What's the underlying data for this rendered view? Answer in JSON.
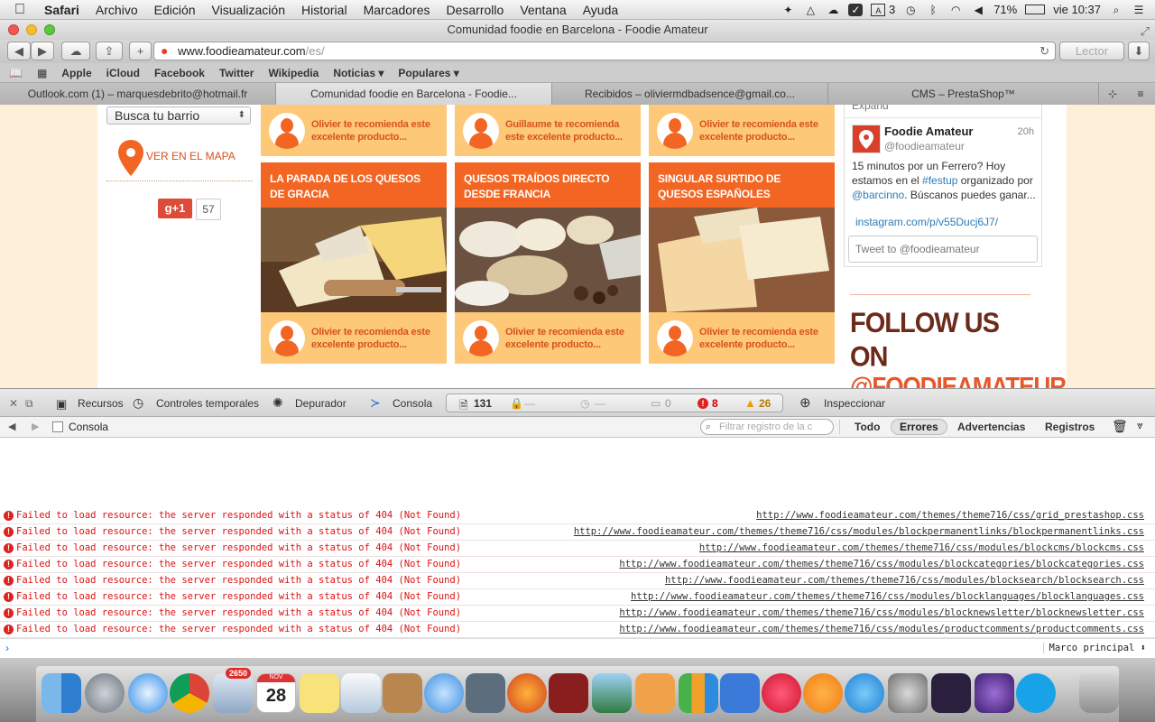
{
  "menubar": {
    "apple": "",
    "app_name": "Safari",
    "items": [
      "Archivo",
      "Edición",
      "Visualización",
      "Historial",
      "Marcadores",
      "Desarrollo",
      "Ventana",
      "Ayuda"
    ],
    "status": {
      "adobe_count": "3",
      "battery": "71%",
      "clock": "vie 10:37"
    }
  },
  "window": {
    "title": "Comunidad foodie en Barcelona - Foodie Amateur",
    "url_domain": "www.foodieamateur.com",
    "url_path": "/es/",
    "reader_label": "Lector"
  },
  "bookmarks": [
    "Apple",
    "iCloud",
    "Facebook",
    "Twitter",
    "Wikipedia",
    "Noticias ▾",
    "Populares ▾"
  ],
  "tabs": [
    {
      "label": "Outlook.com (1) – marquesdebrito@hotmail.fr"
    },
    {
      "label": "Comunidad foodie en Barcelona - Foodie..."
    },
    {
      "label": "Recibidos – oliviermdbadsence@gmail.co..."
    },
    {
      "label": "CMS – PrestaShop™"
    }
  ],
  "sidebar": {
    "neighborhood_select": "Busca tu barrio",
    "map_link": "VER EN EL MAPA",
    "gplus_label": "g+1",
    "gplus_count": "57"
  },
  "cards": {
    "recommendations_top": [
      {
        "text": "Olivier te recomienda este excelente producto..."
      },
      {
        "text": "Guillaume te recomienda este excelente producto..."
      },
      {
        "text": "Olivier te recomienda este excelente producto..."
      }
    ],
    "products": [
      {
        "title": "LA PARADA DE LOS QUESOS DE GRACIA",
        "rec": "Olivier te recomienda este excelente producto..."
      },
      {
        "title": "QUESOS TRAÍDOS DIRECTO DESDE FRANCIA",
        "rec": "Olivier te recomienda este excelente producto..."
      },
      {
        "title": "SINGULAR SURTIDO DE QUESOS ESPAÑOLES",
        "rec": "Olivier te recomienda este excelente producto..."
      }
    ]
  },
  "twitter": {
    "expand": "Expand",
    "name": "Foodie Amateur",
    "handle": "@foodieamateur",
    "time": "20h",
    "text_1": "15 minutos por un Ferrero? Hoy estamos en el ",
    "hashtag": "#festup",
    "text_2": " organizado por ",
    "mention": "@barcinno",
    "text_3": ". Búscanos puedes ganar...",
    "link": "instagram.com/p/v55Ducj6J7/",
    "tweet_placeholder": "Tweet to @foodieamateur",
    "follow_line1": "FOLLOW US ON",
    "follow_line2": "@FOODIEAMATEUR"
  },
  "devtools": {
    "resources": "Recursos",
    "timelines": "Controles temporales",
    "debugger": "Depurador",
    "console": "Consola",
    "count_resources": "131",
    "count_locks": "—",
    "count_time": "—",
    "count_messages": "0",
    "count_errors": "8",
    "count_warnings": "26",
    "inspect": "Inspeccionar",
    "console_label": "Consola",
    "filter_placeholder": "Filtrar registro de la c",
    "filter_all": "Todo",
    "filter_errors": "Errores",
    "filter_warnings": "Advertencias",
    "filter_logs": "Registros",
    "frame": "Marco principal"
  },
  "console_rows": [
    {
      "msg": "Failed to load resource: the server responded with a status of 404 (Not Found)",
      "url": "http://www.foodieamateur.com/themes/theme716/css/grid_prestashop.css"
    },
    {
      "msg": "Failed to load resource: the server responded with a status of 404 (Not Found)",
      "url": "http://www.foodieamateur.com/themes/theme716/css/modules/blockpermanentlinks/blockpermanentlinks.css"
    },
    {
      "msg": "Failed to load resource: the server responded with a status of 404 (Not Found)",
      "url": "http://www.foodieamateur.com/themes/theme716/css/modules/blockcms/blockcms.css"
    },
    {
      "msg": "Failed to load resource: the server responded with a status of 404 (Not Found)",
      "url": "http://www.foodieamateur.com/themes/theme716/css/modules/blockcategories/blockcategories.css"
    },
    {
      "msg": "Failed to load resource: the server responded with a status of 404 (Not Found)",
      "url": "http://www.foodieamateur.com/themes/theme716/css/modules/blocksearch/blocksearch.css"
    },
    {
      "msg": "Failed to load resource: the server responded with a status of 404 (Not Found)",
      "url": "http://www.foodieamateur.com/themes/theme716/css/modules/blocklanguages/blocklanguages.css"
    },
    {
      "msg": "Failed to load resource: the server responded with a status of 404 (Not Found)",
      "url": "http://www.foodieamateur.com/themes/theme716/css/modules/blocknewsletter/blocknewsletter.css"
    },
    {
      "msg": "Failed to load resource: the server responded with a status of 404 (Not Found)",
      "url": "http://www.foodieamateur.com/themes/theme716/css/modules/productcomments/productcomments.css"
    }
  ],
  "dock": {
    "badge_mail": "2650",
    "calendar_month": "NOV",
    "calendar_day": "28",
    "icons": [
      "finder-icon",
      "launchpad-icon",
      "safari-icon",
      "chrome-icon",
      "mail-icon",
      "calendar-icon",
      "notes-icon",
      "preview-icon",
      "contacts-icon",
      "messages-icon",
      "facetime-icon",
      "firefox-icon",
      "photobooth-icon",
      "iphoto-icon",
      "pages-icon",
      "numbers-icon",
      "keynote-icon",
      "itunes-icon",
      "ibooks-icon",
      "appstore-icon",
      "system-preferences-icon",
      "pro-tools-icon",
      "imovie-icon",
      "skype-icon",
      "trash-icon"
    ]
  },
  "colors": {
    "accent": "#f26522",
    "card_bottom": "#fdc978",
    "page_bg": "#fdefd8",
    "error": "#d11"
  }
}
